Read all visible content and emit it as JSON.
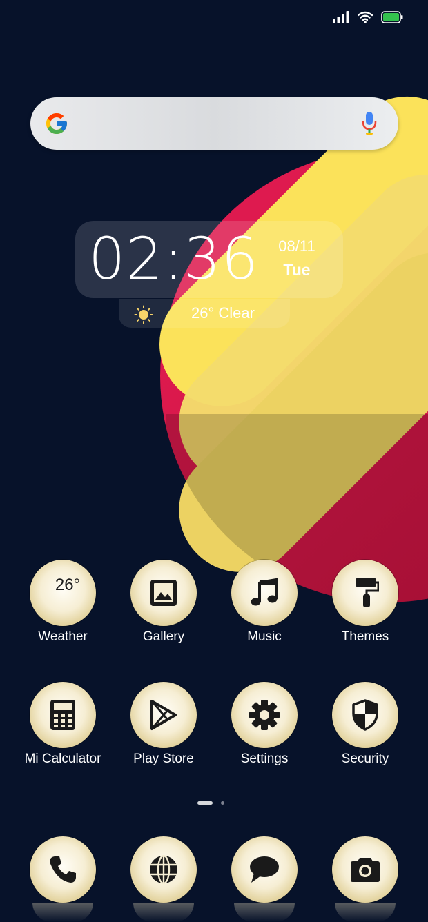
{
  "status": {
    "icons": [
      "signal-icon",
      "wifi-icon",
      "battery-icon"
    ],
    "battery_color": "#34c24e"
  },
  "search": {
    "icons": [
      "google-logo-icon",
      "microphone-icon"
    ]
  },
  "clock": {
    "time": "02:36",
    "date": "08/11",
    "day": "Tue"
  },
  "weather_widget": {
    "icon": "sun-icon",
    "text": "26° Clear"
  },
  "apps": [
    {
      "label": "Weather",
      "icon": "weather-icon",
      "temp": "26°"
    },
    {
      "label": "Gallery",
      "icon": "gallery-icon"
    },
    {
      "label": "Music",
      "icon": "music-note-icon"
    },
    {
      "label": "Themes",
      "icon": "paint-roller-icon"
    },
    {
      "label": "Mi Calculator",
      "icon": "calculator-icon"
    },
    {
      "label": "Play Store",
      "icon": "play-store-icon"
    },
    {
      "label": "Settings",
      "icon": "gear-icon"
    },
    {
      "label": "Security",
      "icon": "shield-icon"
    }
  ],
  "page_indicator": {
    "current": 1,
    "total": 2
  },
  "dock": [
    {
      "icon": "phone-icon"
    },
    {
      "icon": "browser-globe-icon"
    },
    {
      "icon": "messages-icon"
    },
    {
      "icon": "camera-icon"
    }
  ],
  "colors": {
    "background": "#07122a",
    "wallpaper_red": "#dc1a4d",
    "wallpaper_yellow": "#f5e06a",
    "icon_cream": "#f6eed4"
  }
}
